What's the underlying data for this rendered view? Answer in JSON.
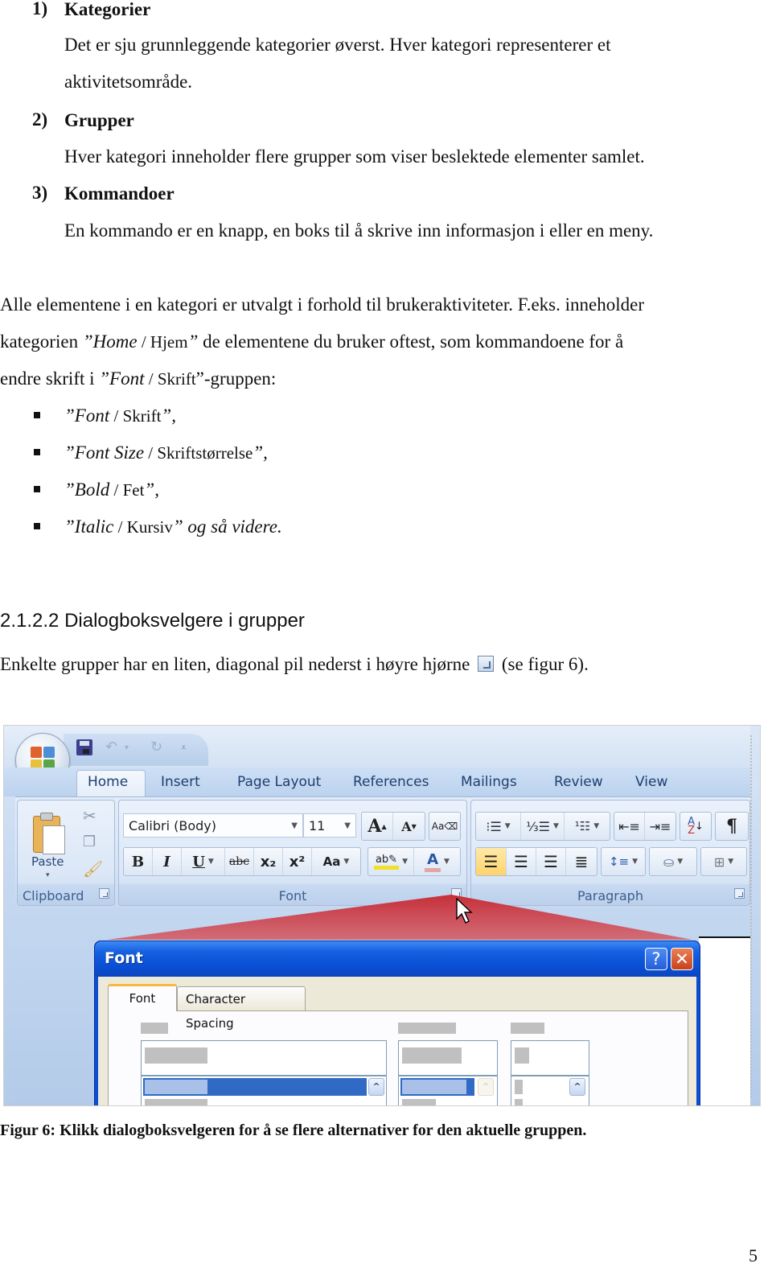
{
  "list": [
    {
      "number": "1)",
      "title": "Kategorier",
      "lines": [
        "Det er sju grunnleggende kategorier øverst. Hver kategori representerer et",
        "aktivitetsområde."
      ]
    },
    {
      "number": "2)",
      "title": "Grupper",
      "lines": [
        "Hver kategori inneholder flere grupper som viser beslektede elementer samlet."
      ]
    },
    {
      "number": "3)",
      "title": "Kommandoer",
      "lines": [
        "En kommando er en knapp, en boks til å skrive inn informasjon i eller en meny."
      ]
    }
  ],
  "paragraph": {
    "line1": "Alle elementene i en kategori er utvalgt i forhold til brukeraktiviteter. F.eks. inneholder",
    "line2_a": "kategorien ",
    "line2_it": "”Home",
    "line2_sl": " / Hjem",
    "line2_q": "”",
    "line2_b": " de elementene du bruker oftest, som kommandoene for å",
    "line3_a": "endre skrift i ",
    "line3_it": "”Font",
    "line3_sl": " / Skrift",
    "line3_b": "”-gruppen:"
  },
  "bullets": [
    {
      "en": "”Font",
      "no": " / Skrift",
      "tail": "”,"
    },
    {
      "en": "”Font Size",
      "no": " / Skriftstørrelse",
      "tail": "”,"
    },
    {
      "en": "”Bold",
      "no": " / Fet",
      "tail": "”,"
    },
    {
      "en": "”Italic",
      "no": " / Kursiv",
      "tail": "” og så videre."
    }
  ],
  "section": {
    "heading": "2.1.2.2  Dialogboksvelgere i grupper",
    "text_a": "Enkelte grupper har en liten, diagonal pil nederst i høyre hjørne",
    "text_b": "(se figur 6).",
    "launcher_icon": "dialog-launcher-icon"
  },
  "figure": {
    "ribbon_tabs": [
      "Home",
      "Insert",
      "Page Layout",
      "References",
      "Mailings",
      "Review",
      "View"
    ],
    "active_tab": "Home",
    "groups": {
      "clipboard": {
        "label": "Clipboard",
        "paste_label": "Paste"
      },
      "font": {
        "label": "Font",
        "font_name": "Calibri (Body)",
        "font_size": "11",
        "buttons": [
          "B",
          "I",
          "U",
          "abc",
          "x₂",
          "x²",
          "Aa"
        ]
      },
      "paragraph": {
        "label": "Paragraph"
      }
    },
    "highlight_color": "#c9353f",
    "dialog": {
      "title": "Font",
      "help_label": "?",
      "close_label": "✕",
      "tabs": [
        "Font",
        "Character Spacing"
      ],
      "active_tab": "Font"
    }
  },
  "caption": "Figur 6: Klikk dialogboksvelgeren for å se flere alternativer for den aktuelle gruppen.",
  "page_number": "5"
}
